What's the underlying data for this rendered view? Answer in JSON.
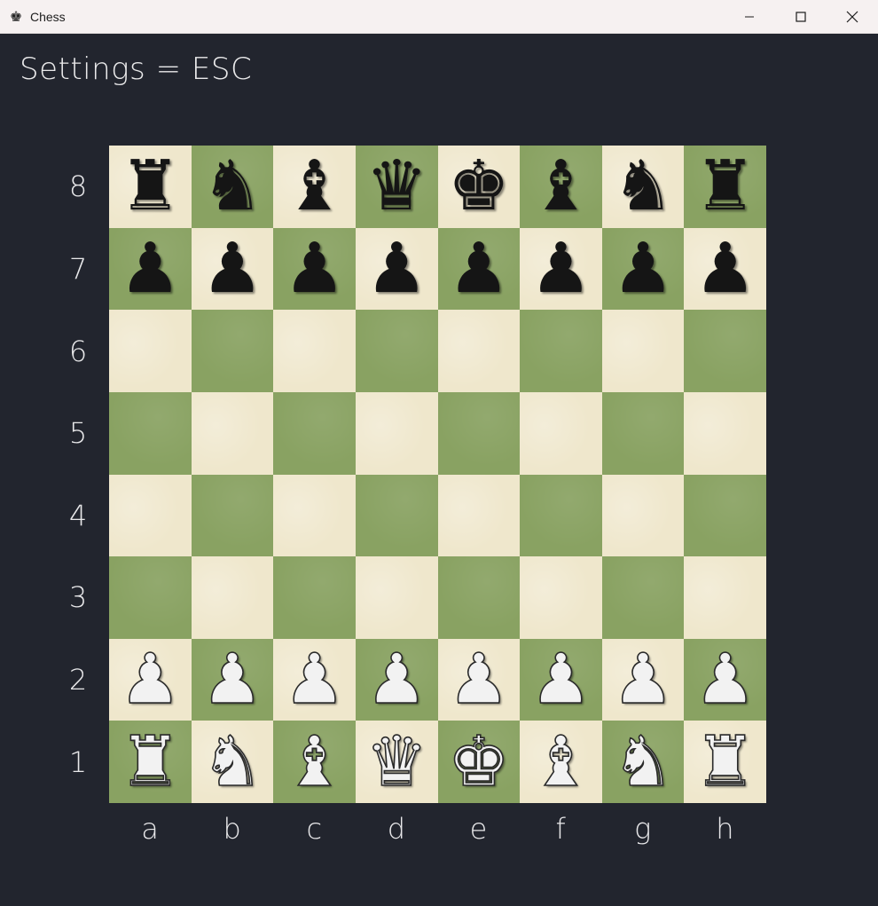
{
  "window": {
    "title": "Chess",
    "icon": "chess-king-icon"
  },
  "settings_hint": "Settings = ESC",
  "board": {
    "light_color": "#efe7cc",
    "dark_color": "#89a262",
    "ranks": [
      "8",
      "7",
      "6",
      "5",
      "4",
      "3",
      "2",
      "1"
    ],
    "files": [
      "a",
      "b",
      "c",
      "d",
      "e",
      "f",
      "g",
      "h"
    ],
    "position": [
      [
        "br",
        "bn",
        "bb",
        "bq",
        "bk",
        "bb",
        "bn",
        "br"
      ],
      [
        "bp",
        "bp",
        "bp",
        "bp",
        "bp",
        "bp",
        "bp",
        "bp"
      ],
      [
        "",
        "",
        "",
        "",
        "",
        "",
        "",
        ""
      ],
      [
        "",
        "",
        "",
        "",
        "",
        "",
        "",
        ""
      ],
      [
        "",
        "",
        "",
        "",
        "",
        "",
        "",
        ""
      ],
      [
        "",
        "",
        "",
        "",
        "",
        "",
        "",
        ""
      ],
      [
        "wp",
        "wp",
        "wp",
        "wp",
        "wp",
        "wp",
        "wp",
        "wp"
      ],
      [
        "wr",
        "wn",
        "wb",
        "wq",
        "wk",
        "wb",
        "wn",
        "wr"
      ]
    ]
  }
}
